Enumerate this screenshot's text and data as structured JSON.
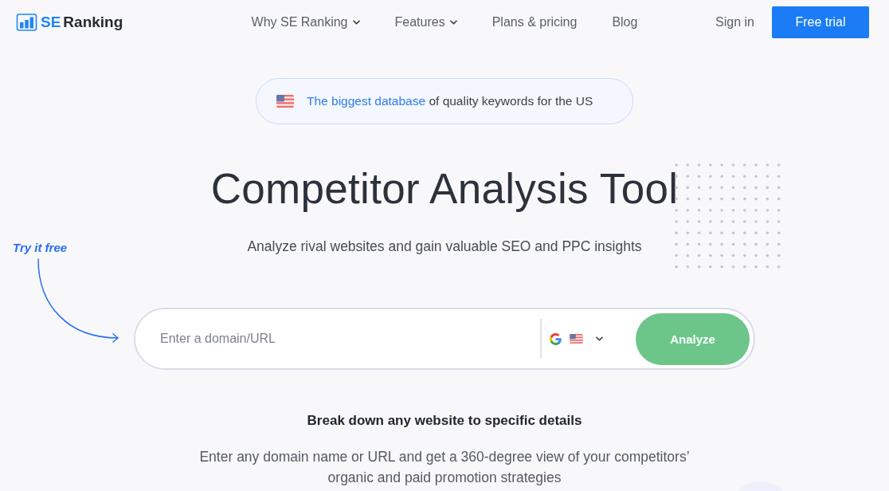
{
  "header": {
    "logo": {
      "accent": "SE",
      "name": "Ranking"
    },
    "nav": [
      {
        "label": "Why SE Ranking",
        "dropdown": true
      },
      {
        "label": "Features",
        "dropdown": true
      },
      {
        "label": "Plans & pricing",
        "dropdown": false
      },
      {
        "label": "Blog",
        "dropdown": false
      }
    ],
    "sign_in": "Sign in",
    "cta": "Free trial"
  },
  "banner": {
    "link": "The biggest database",
    "text": "of quality keywords for the US"
  },
  "hero": {
    "title": "Competitor Analysis Tool",
    "subtitle": "Analyze rival websites and gain valuable SEO and PPC insights",
    "annotation": "Try it free"
  },
  "search": {
    "placeholder": "Enter a domain/URL",
    "button": "Analyze"
  },
  "details": {
    "heading": "Break down any website to specific details",
    "text": "Enter any domain name or URL and get a 360-degree view of your competitors’ organic and paid promotion strategies"
  }
}
